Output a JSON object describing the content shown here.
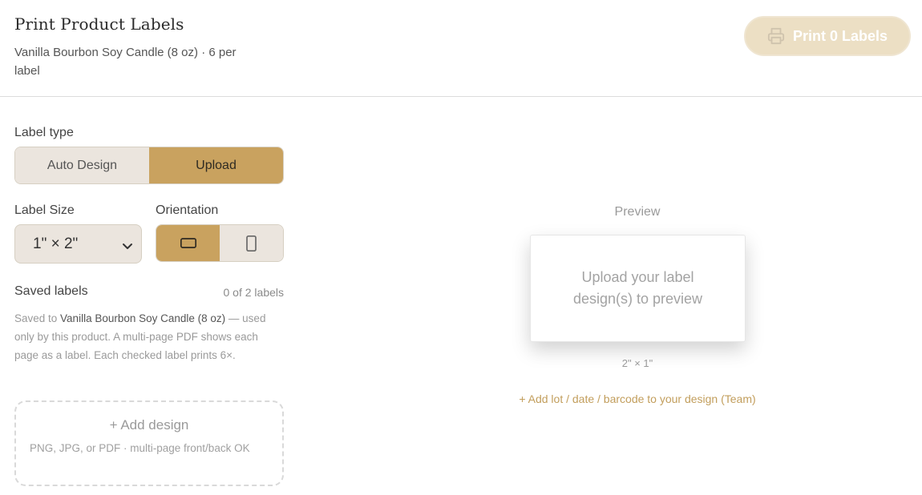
{
  "header": {
    "title": "Print Product Labels",
    "subtitle": "Vanilla Bourbon Soy Candle (8 oz) · 6 per label",
    "print_button_label": "Print 0 Labels"
  },
  "label_type": {
    "heading": "Label type",
    "options": [
      "Auto Design",
      "Upload"
    ],
    "selected": "Upload"
  },
  "label_size": {
    "heading": "Label Size",
    "selected": "1\" × 2\""
  },
  "orientation": {
    "heading": "Orientation",
    "options": [
      "landscape",
      "portrait"
    ],
    "selected": "landscape"
  },
  "saved_labels": {
    "heading": "Saved labels",
    "count_text": "0 of 2 labels",
    "desc_prefix": "Saved to ",
    "product_name": "Vanilla Bourbon Soy Candle (8 oz)",
    "desc_suffix": " — used only by this product. A multi-page PDF shows each page as a label. Each checked label prints 6×."
  },
  "dropzone": {
    "title": "+ Add design",
    "hint": "PNG, JPG, or PDF · multi-page front/back OK"
  },
  "preview": {
    "heading": "Preview",
    "empty_text": "Upload your label design(s) to preview",
    "dimensions": "2\" × 1\"",
    "add_link": "+ Add lot / date / barcode to your design (Team)"
  },
  "colors": {
    "accent": "#c9a25f",
    "accent_disabled": "#ecdfc4",
    "link": "#c29e5c"
  },
  "icons": {
    "print": "printer-icon",
    "chevron": "chevron-down-icon",
    "landscape": "landscape-orientation-icon",
    "portrait": "portrait-orientation-icon"
  }
}
